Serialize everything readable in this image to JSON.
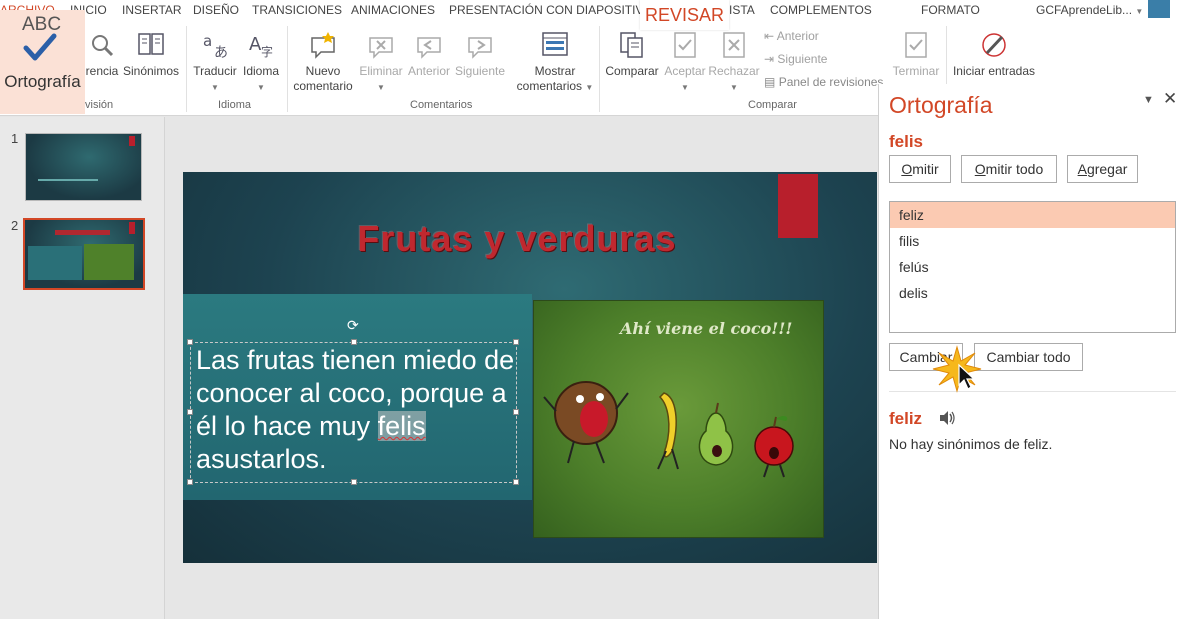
{
  "tabs": [
    "ARCHIVO",
    "INICIO",
    "INSERTAR",
    "DISEÑO",
    "TRANSICIONES",
    "ANIMACIONES",
    "PRESENTACIÓN CON DIAPOSITIVAS",
    "REVISAR",
    "VISTA",
    "COMPLEMENTOS",
    "FORMATO"
  ],
  "tab_visible_fragments": {
    "archivo": "ARCHIVO",
    "vista": "ISTA"
  },
  "account_name": "GCFAprendeLib...",
  "ribbon": {
    "ortografia": {
      "abc": "ABC",
      "label": "Ortografía"
    },
    "referencia": "rencia",
    "sinonimos": "Sinónimos",
    "revision_group": "visión",
    "traducir": "Traducir",
    "idioma": "Idioma",
    "idioma_group": "Idioma",
    "nuevo_comentario": [
      "Nuevo",
      "comentario"
    ],
    "eliminar": "Eliminar",
    "anterior": "Anterior",
    "siguiente": "Siguiente",
    "mostrar_comentarios": [
      "Mostrar",
      "comentarios"
    ],
    "comentarios_group": "Comentarios",
    "comparar": "Comparar",
    "aceptar": "Aceptar",
    "rechazar": "Rechazar",
    "anterior_small": "Anterior",
    "siguiente_small": "Siguiente",
    "panel_revisiones": "Panel de revisiones",
    "comparar_group": "Comparar",
    "terminar": "Terminar",
    "iniciar_entradas": "Iniciar entradas"
  },
  "thumbnails": [
    "1",
    "2"
  ],
  "slide": {
    "title": "Frutas y verduras",
    "body_before": "Las frutas tienen miedo de conocer al coco, porque a él lo hace muy ",
    "body_word": "felis",
    "body_after": " asustarlos.",
    "picture_caption": "Ahí viene el coco!!!"
  },
  "pane": {
    "title": "Ortografía",
    "misspelled": "felis",
    "buttons": {
      "omitir": "Omitir",
      "omitir_todo": "Omitir todo",
      "agregar": "Agregar",
      "cambiar": "Cambiar",
      "cambiar_todo": "Cambiar todo"
    },
    "suggestions": [
      "feliz",
      "filis",
      "felús",
      "delis"
    ],
    "selected_suggestion": "feliz",
    "synonym_word": "feliz",
    "synonym_text": "No hay sinónimos de feliz."
  },
  "colors": {
    "accent": "#d24726",
    "selection": "#fbcab2",
    "slide_title": "#c0282f"
  }
}
